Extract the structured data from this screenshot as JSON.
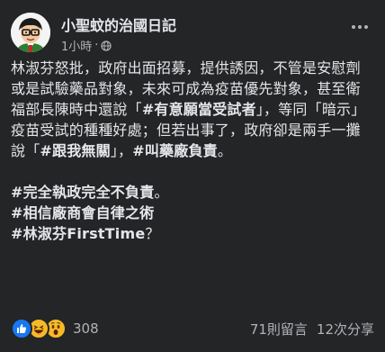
{
  "post": {
    "page_name": "小聖蚊的治國日記",
    "time": "1小時",
    "dot": "·",
    "body": {
      "p1_a": "林淑芬怒批，政府出面招募，提供誘因，不管是安慰劑或是試驗藥品對象，未來可成為疫苗優先對象，甚至衛福部長陳時中還說「",
      "p1_tag1": "#有意願當受試者",
      "p1_b": "」，等同「暗示」疫苗受試的種種好處；但若出事了，政府卻是兩手一攤說「",
      "p1_tag2": "#跟我無關",
      "p1_c": "」，",
      "p1_tag3": "#叫藥廠負責",
      "p1_d": "。",
      "tags": [
        "#完全執政完全不負責",
        "#相信廠商會自律之術",
        "#林淑芬FirstTime"
      ],
      "last_suffix": "？",
      "tag1_suffix": "。"
    },
    "reactions": {
      "count": "308",
      "icons": [
        "like-icon",
        "haha-icon",
        "wow-icon"
      ]
    },
    "comments": "71則留言",
    "shares": "12次分享"
  },
  "colors": {
    "background": "#242526",
    "text": "#e4e6eb",
    "secondary": "#b0b3b8",
    "like": "#1877f2",
    "emoji": "#f7b928"
  }
}
